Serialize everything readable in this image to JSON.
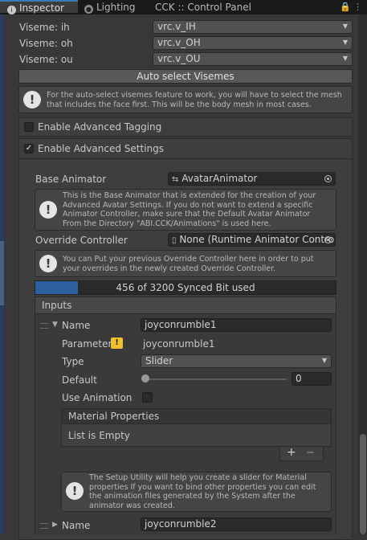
{
  "tabs": [
    {
      "label": "Inspector",
      "active": true,
      "icon": "info-icon"
    },
    {
      "label": "Lighting",
      "active": false,
      "icon": "bulb-icon"
    },
    {
      "label": "CCK :: Control Panel",
      "active": false
    }
  ],
  "visemes": [
    {
      "label": "Viseme: ih",
      "value": "vrc.v_IH"
    },
    {
      "label": "Viseme: oh",
      "value": "vrc.v_OH"
    },
    {
      "label": "Viseme: ou",
      "value": "vrc.v_OU"
    }
  ],
  "auto_select_button": "Auto select Visemes",
  "help_visemes": "For the auto-select visemes feature to work, you will have to select the mesh that includes the face first. This will be the body mesh in most cases.",
  "advanced_tagging": {
    "label": "Enable Advanced Tagging",
    "checked": false
  },
  "advanced_settings": {
    "label": "Enable Advanced Settings",
    "checked": true
  },
  "base_animator": {
    "label": "Base Animator",
    "value": "AvatarAnimator"
  },
  "help_base_animator": "This is the Base Animator that is extended for the creation of your Advanced Avatar Settings. If you do not want to extend a specific Animator Controller, make sure that the Default Avatar Animator From the Directory \"ABI.CCK/Animations\" is used here.",
  "override_controller": {
    "label": "Override Controller",
    "value": "None (Runtime Animator Contro"
  },
  "help_override": "You can Put your previous Override Controller here in order to put your overrides in the newly created Override Controller.",
  "synced_bits": {
    "text": "456 of 3200 Synced Bit used",
    "used": 456,
    "total": 3200
  },
  "inputs_header": "Inputs",
  "input1": {
    "name_label": "Name",
    "name_value": "joyconrumble1",
    "parameter_label": "Parameter",
    "parameter_value": "joyconrumble1",
    "type_label": "Type",
    "type_value": "Slider",
    "default_label": "Default",
    "default_value": "0",
    "default_slider": 0,
    "use_animation_label": "Use Animation",
    "use_animation_checked": false
  },
  "material_properties": {
    "header": "Material Properties",
    "empty_text": "List is Empty",
    "add": "+",
    "remove": "−"
  },
  "help_setup_utility": "The Setup Utility will help you create a slider for Material properties If you want to bind other properties you can edit the animation files generated by the System after the animator was created.",
  "input2": {
    "name_label": "Name",
    "name_value": "joyconrumble2"
  },
  "colors": {
    "accent": "#3a79bb",
    "progress_fill": "#2f5f9e",
    "warning": "#f2c12e"
  }
}
